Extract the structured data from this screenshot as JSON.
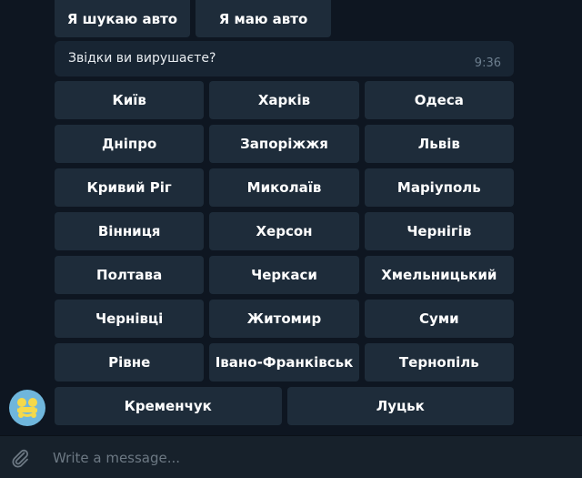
{
  "mode_buttons": [
    {
      "label": "Я шукаю авто"
    },
    {
      "label": "Я маю авто"
    }
  ],
  "message": {
    "text": "Звідки ви вирушаєте?",
    "time": "9:36"
  },
  "keyboard": {
    "rows": [
      [
        "Київ",
        "Харків",
        "Одеса"
      ],
      [
        "Дніпро",
        "Запоріжжя",
        "Львів"
      ],
      [
        "Кривий Ріг",
        "Миколаїв",
        "Маріуполь"
      ],
      [
        "Вінниця",
        "Херсон",
        "Чернігів"
      ],
      [
        "Полтава",
        "Черкаси",
        "Хмельницький"
      ],
      [
        "Чернівці",
        "Житомир",
        "Суми"
      ],
      [
        "Рівне",
        "Івано-Франківськ",
        "Тернопіль"
      ],
      [
        "Кременчук",
        "Луцьк"
      ]
    ]
  },
  "composer": {
    "placeholder": "Write a message..."
  },
  "colors": {
    "background": "#0e1621",
    "button": "#1e2c3a",
    "bubble": "#182533",
    "composer": "#17212b",
    "avatar_bg": "#6fb6dc",
    "avatar_fg": "#f5d94a"
  }
}
